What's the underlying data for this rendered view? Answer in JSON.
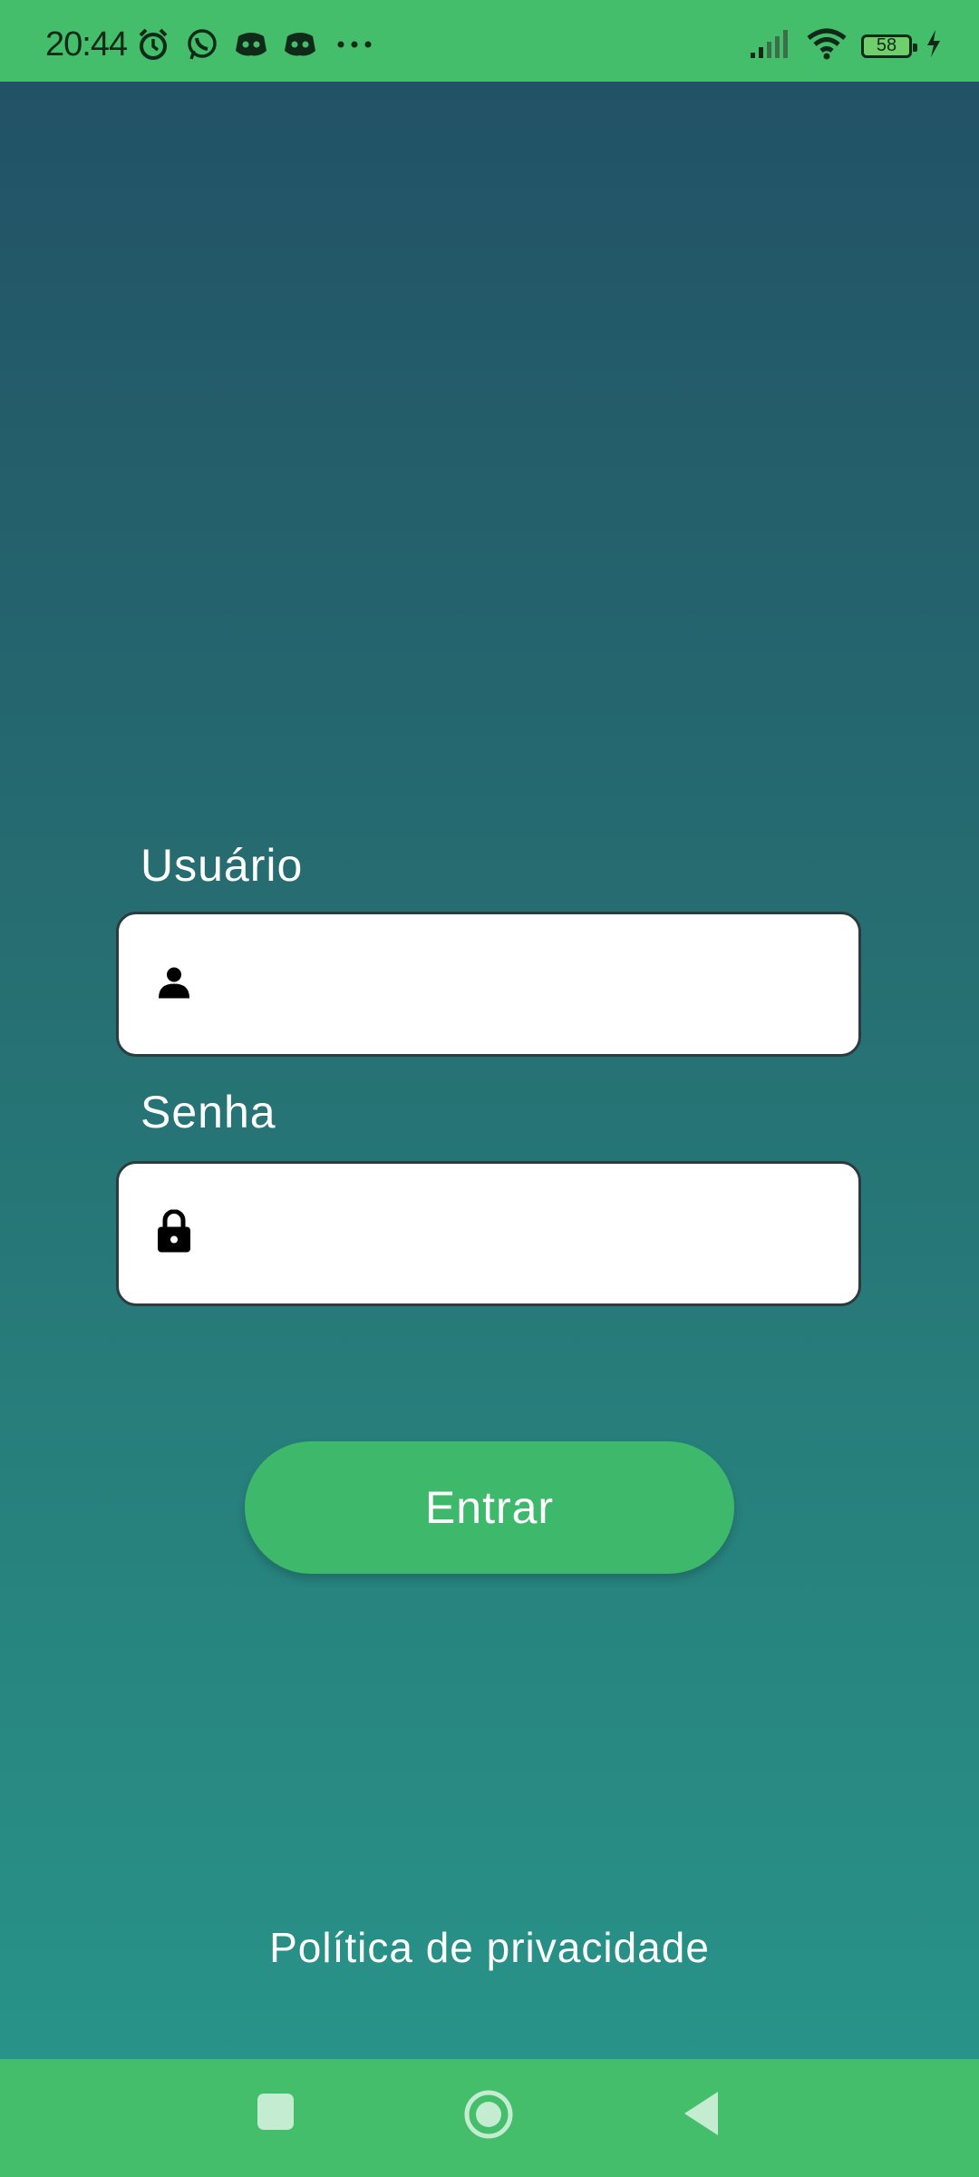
{
  "status_bar": {
    "time": "20:44",
    "battery": "58",
    "icons": [
      "alarm-icon",
      "whatsapp-icon",
      "discord-icon",
      "discord-icon",
      "more-icon",
      "signal-icon",
      "wifi-icon",
      "battery-icon",
      "charging-icon"
    ]
  },
  "login": {
    "username_label": "Usuário",
    "username_value": "",
    "password_label": "Senha",
    "password_value": "",
    "submit_label": "Entrar",
    "privacy_link": "Política de privacidade"
  },
  "colors": {
    "accent": "#45be6b",
    "button": "#3eb86a",
    "gradient_top": "#225266",
    "gradient_bottom": "#289388"
  }
}
